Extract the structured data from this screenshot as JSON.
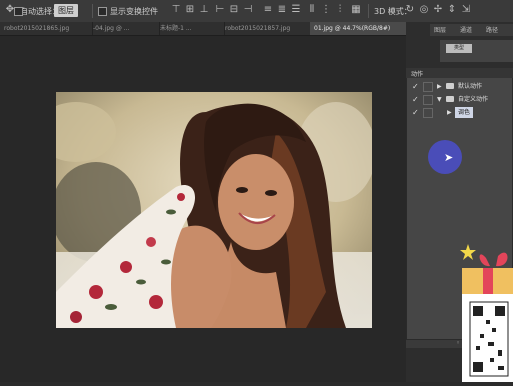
{
  "options_bar": {
    "auto_select_label": "自动选择：",
    "auto_select_value": "图层",
    "show_transform_label": "显示变换控件",
    "mode_3d_label": "3D 模式："
  },
  "doc_tabs": [
    {
      "label": "robot2015021865.jpg",
      "active": false
    },
    {
      "label": "-04.jpg @ ...",
      "active": false
    },
    {
      "label": "未标题-1 ...",
      "active": false
    },
    {
      "label": "robot2015021857.jpg",
      "active": false
    },
    {
      "label": "01.jpg @ 44.7%(RGB/8#)",
      "active": true
    }
  ],
  "right_panel": {
    "top_tabs": [
      "图层",
      "通道",
      "路径"
    ],
    "mini_dropdown": "类型"
  },
  "actions_panel": {
    "title": "动作",
    "rows": [
      {
        "check": "✓",
        "label": "默认动作",
        "level": 0,
        "selected": false
      },
      {
        "check": "✓",
        "label": "自定义动作",
        "level": 0,
        "selected": false
      },
      {
        "check": "✓",
        "label": "调色",
        "level": 1,
        "selected": true
      }
    ]
  },
  "colors": {
    "accent_circle": "#4a4db8",
    "panel_bg": "#464646",
    "app_bg": "#2b2b2b"
  }
}
